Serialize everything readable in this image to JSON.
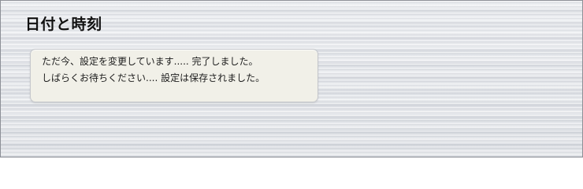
{
  "page": {
    "title": "日付と時刻"
  },
  "status": {
    "lines": [
      "ただ今、設定を変更しています..... 完了しました。",
      "しばらくお待ちください.... 設定は保存されました。"
    ]
  }
}
